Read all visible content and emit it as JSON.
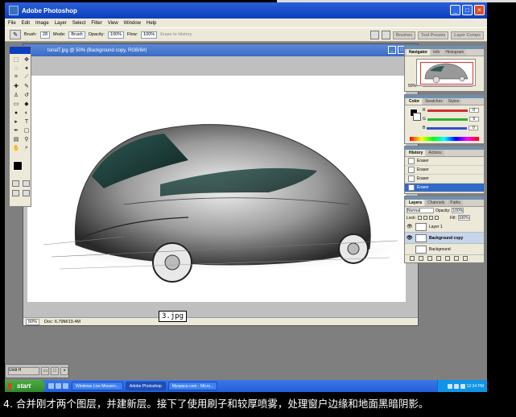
{
  "window": {
    "title": "Adobe Photoshop",
    "controls": [
      "_",
      "□",
      "×"
    ]
  },
  "menu": [
    "File",
    "Edit",
    "Image",
    "Layer",
    "Select",
    "Filter",
    "View",
    "Window",
    "Help"
  ],
  "options": {
    "brush_label": "Brush:",
    "brush_size": "28",
    "mode_label": "Mode:",
    "mode_value": "Brush",
    "opacity_label": "Opacity:",
    "opacity_value": "100%",
    "flow_label": "Flow:",
    "flow_value": "100%",
    "erase_history": "Erase to History",
    "well_tabs": [
      "Brushes",
      "Tool Presets",
      "Layer Comps"
    ]
  },
  "document": {
    "title": "torialT.jpg @ 50% (Background copy, RGB/8#)",
    "zoom": "50%",
    "doc_info": "Doc: 6.79M/19.4M"
  },
  "navigator": {
    "tabs": [
      "Navigator",
      "Info",
      "Histogram"
    ],
    "zoom": "50%"
  },
  "color": {
    "tabs": [
      "Color",
      "Swatches",
      "Styles"
    ],
    "channels": [
      {
        "label": "R",
        "value": "0",
        "color": "#d03030"
      },
      {
        "label": "G",
        "value": "0",
        "color": "#30b030"
      },
      {
        "label": "B",
        "value": "0",
        "color": "#3050d0"
      }
    ]
  },
  "history": {
    "tabs": [
      "History",
      "Actions"
    ],
    "items": [
      "Eraser",
      "Eraser",
      "Eraser",
      "Eraser"
    ]
  },
  "layers": {
    "tabs": [
      "Layers",
      "Channels",
      "Paths"
    ],
    "blend": "Normal",
    "opacity_label": "Opacity:",
    "opacity": "100%",
    "lock_label": "Lock:",
    "fill_label": "Fill:",
    "fill": "100%",
    "items": [
      {
        "name": "Layer 1"
      },
      {
        "name": "Background copy"
      },
      {
        "name": "Background"
      }
    ]
  },
  "image_tag": "3.jpg",
  "taskbar": {
    "start": "start",
    "tasks": [
      "Windows Live Messen...",
      "Adobe Photoshop",
      "Myspace.com - Micro..."
    ],
    "clock": "12:34 PM",
    "tray_label": "Untit H"
  },
  "caption": "4. 合并刚才两个图层，并建新层。接下了使用刷子和较厚喷雾，处理窗户边缘和地面黑暗阴影。"
}
